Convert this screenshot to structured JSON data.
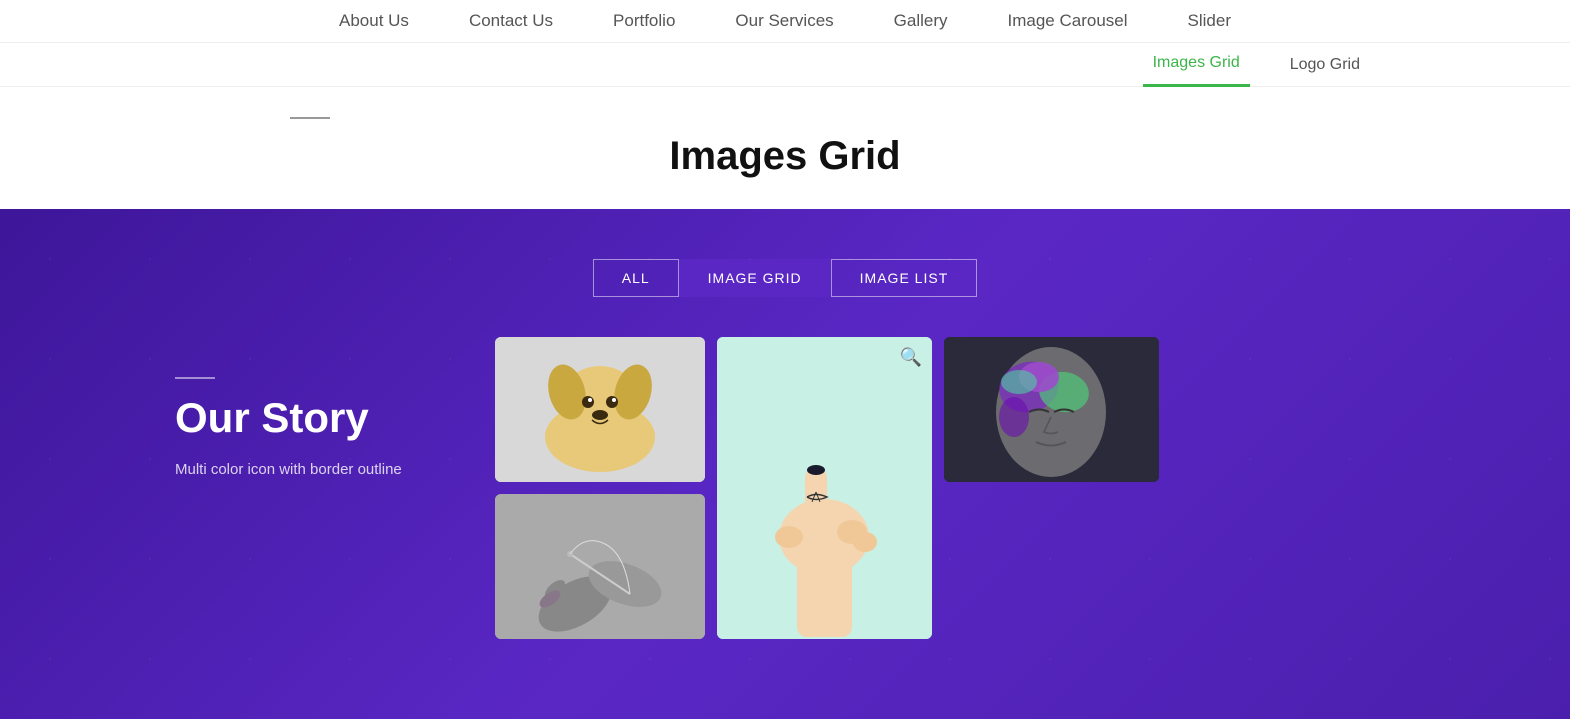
{
  "nav": {
    "items": [
      {
        "label": "About Us",
        "id": "about-us"
      },
      {
        "label": "Contact Us",
        "id": "contact-us"
      },
      {
        "label": "Portfolio",
        "id": "portfolio"
      },
      {
        "label": "Our Services",
        "id": "our-services"
      },
      {
        "label": "Gallery",
        "id": "gallery"
      },
      {
        "label": "Image Carousel",
        "id": "image-carousel"
      },
      {
        "label": "Slider",
        "id": "slider"
      }
    ]
  },
  "subnav": {
    "items": [
      {
        "label": "Images Grid",
        "id": "images-grid",
        "active": true
      },
      {
        "label": "Logo Grid",
        "id": "logo-grid",
        "active": false
      }
    ]
  },
  "page": {
    "title": "Images Grid"
  },
  "filter": {
    "buttons": [
      {
        "label": "ALL",
        "id": "all",
        "active": false
      },
      {
        "label": "IMAGE GRID",
        "id": "image-grid",
        "active": true
      },
      {
        "label": "IMAGE LIST",
        "id": "image-list",
        "active": false
      }
    ]
  },
  "story": {
    "title": "Our Story",
    "description": "Multi color icon with border outline"
  },
  "images": {
    "puppy_alt": "Golden retriever puppy",
    "needle_alt": "Person threading needle black and white",
    "hand_alt": "Hand pointing with tattoo",
    "face_alt": "Artistic face with paint"
  },
  "zoom_icon": "⊕"
}
